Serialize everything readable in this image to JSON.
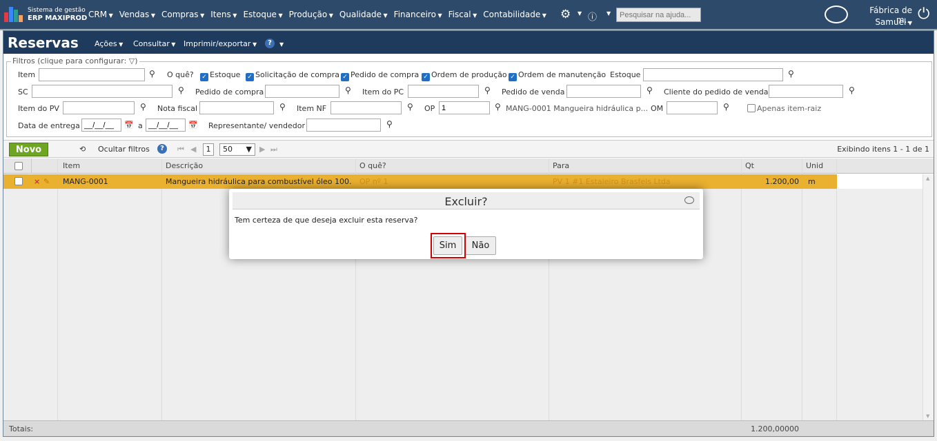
{
  "brand": {
    "line1": "Sistema de gestão",
    "line2": "ERP MAXIPROD"
  },
  "menu": [
    "CRM",
    "Vendas",
    "Compras",
    "Itens",
    "Estoque",
    "Produção",
    "Qualidade",
    "Financeiro",
    "Fiscal",
    "Contabilidade"
  ],
  "search": {
    "placeholder": "Pesquisar na ajuda..."
  },
  "account": {
    "company": "Fábrica de m...",
    "user": "Samuel"
  },
  "page": {
    "title": "Reservas",
    "menus": [
      "Ações",
      "Consultar",
      "Imprimir/exportar"
    ]
  },
  "filters": {
    "legend": "Filtros (clique para configurar:",
    "item_label": "Item",
    "oque_label": "O quê?",
    "checks": [
      "Estoque",
      "Solicitação de compra",
      "Pedido de compra",
      "Ordem de produção",
      "Ordem de manutenção"
    ],
    "estoque_label": "Estoque",
    "sc_label": "SC",
    "pedido_compra_label": "Pedido de compra",
    "item_pc_label": "Item do PC",
    "pedido_venda_label": "Pedido de venda",
    "cliente_pv_label": "Cliente do pedido de venda",
    "item_pv_label": "Item do PV",
    "nota_fiscal_label": "Nota fiscal",
    "item_nf_label": "Item NF",
    "op_label": "OP",
    "op_value": "1",
    "op_desc": "MANG-0001 Mangueira hidráulica p...",
    "om_label": "OM",
    "apenas_label": "Apenas item-raiz",
    "data_label": "Data de entrega",
    "date_mask": "__/__/__",
    "date_sep": "a",
    "rep_label": "Representante/ vendedor"
  },
  "toolbar": {
    "novo": "Novo",
    "ocultar": "Ocultar filtros",
    "page": "1",
    "per_page": "50",
    "exibindo": "Exibindo itens 1 - 1 de 1"
  },
  "grid": {
    "headers": [
      "Item",
      "Descrição",
      "O quê?",
      "Para",
      "Qt",
      "Unid"
    ],
    "row": {
      "item": "MANG-0001",
      "descricao": "Mangueira hidráulica para combustível óleo 100...",
      "oque": "OP nº 1",
      "para": "PV 1 #1 Estaleiro Brasfels Ltda",
      "qt": "1.200,00",
      "unid": "m"
    },
    "totals_label": "Totais:",
    "totals_qt": "1.200,00000"
  },
  "dialog": {
    "title": "Excluir?",
    "message": "Tem certeza de que deseja excluir esta reserva?",
    "yes": "Sim",
    "no": "Não"
  },
  "colors": {
    "nav": "#2d4a6b",
    "title_bar": "#1e3a5c",
    "accent_green": "#6ea521",
    "row_selected": "#eab130",
    "highlight": "#d40000"
  }
}
